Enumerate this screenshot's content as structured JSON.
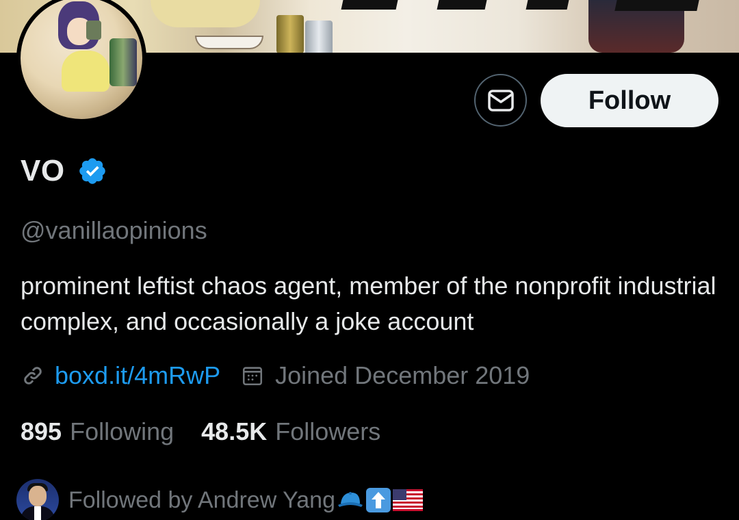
{
  "profile": {
    "display_name": "VO",
    "verified": true,
    "handle": "@vanillaopinions",
    "bio": "prominent leftist chaos agent, member of the nonprofit industrial complex, and occasionally a joke account",
    "link": "boxd.it/4mRwP",
    "joined": "Joined December 2019"
  },
  "actions": {
    "follow_label": "Follow",
    "message_icon": "envelope-icon"
  },
  "stats": {
    "following_count": "895",
    "following_label": "Following",
    "followers_count": "48.5K",
    "followers_label": "Followers"
  },
  "followed_by": {
    "text": "Followed by Andrew Yang",
    "emojis": [
      "blue-cap",
      "up-arrow",
      "us-flag"
    ]
  },
  "colors": {
    "background": "#000000",
    "text_primary": "#e7e9ea",
    "text_secondary": "#71767b",
    "link": "#1d9bf0",
    "verified_badge": "#1d9bf0",
    "follow_button_bg": "#eff3f4",
    "follow_button_text": "#0f1419",
    "border": "#536471"
  }
}
